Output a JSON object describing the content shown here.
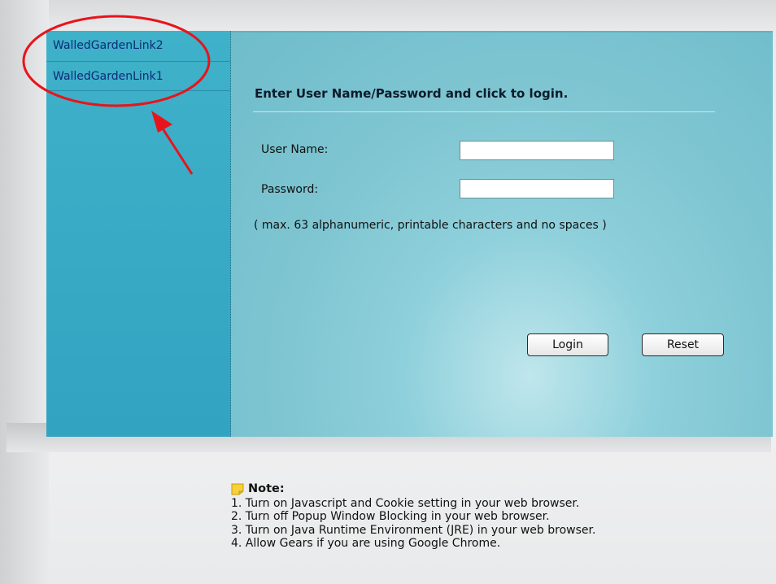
{
  "sidebar": {
    "items": [
      {
        "label": "WalledGardenLink2"
      },
      {
        "label": "WalledGardenLink1"
      }
    ]
  },
  "login": {
    "title": "Enter User Name/Password and click to login.",
    "username_label": "User Name:",
    "username_value": "",
    "password_label": "Password:",
    "password_value": "",
    "hint": "( max. 63 alphanumeric, printable characters and no spaces )",
    "login_label": "Login",
    "reset_label": "Reset"
  },
  "note": {
    "heading": "Note:",
    "icon": "note-icon",
    "lines": [
      "1. Turn on Javascript and Cookie setting in your web browser.",
      "2. Turn off Popup Window Blocking in your web browser.",
      "3. Turn on Java Runtime Environment (JRE) in your web browser.",
      "4. Allow Gears if you are using Google Chrome."
    ]
  },
  "annotation": {
    "color": "#e8141b"
  },
  "colors": {
    "sidebar": "#3fb1c9",
    "panel": "#8ed0db",
    "link": "#0e2c78"
  }
}
